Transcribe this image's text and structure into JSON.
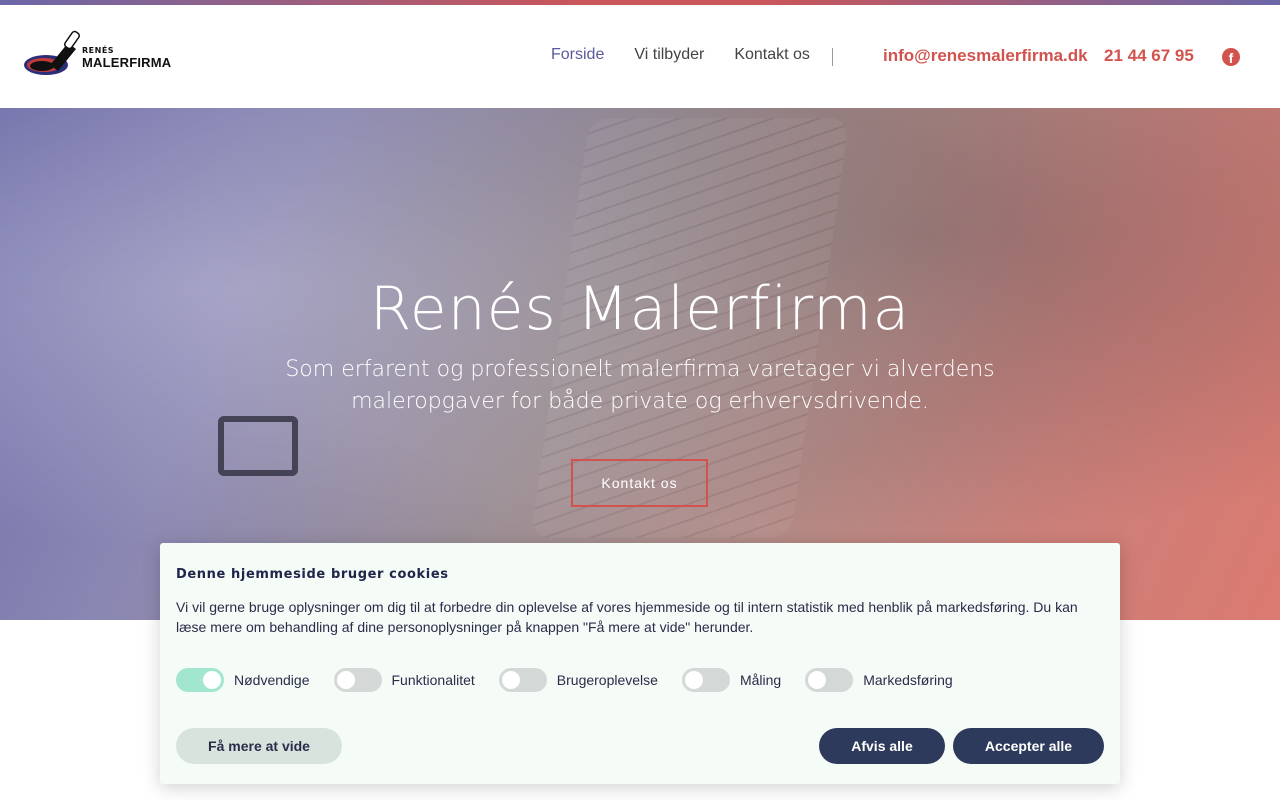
{
  "brand": {
    "small": "RENÉS",
    "big": "MALERFIRMA",
    "colors": {
      "accent": "#d2534d",
      "nav_active": "#5b5a9c",
      "dark": "#2e3a5c"
    }
  },
  "nav": {
    "items": [
      {
        "label": "Forside",
        "active": true
      },
      {
        "label": "Vi tilbyder",
        "active": false
      },
      {
        "label": "Kontakt os",
        "active": false
      }
    ]
  },
  "contact": {
    "email": "info@renesmalerfirma.dk",
    "phone": "21 44 67 95",
    "social_icon": "facebook-icon",
    "social_glyph": "f"
  },
  "hero": {
    "title": "Renés Malerfirma",
    "subtitle": "Som erfarent og professionelt malerfirma varetager vi alverdens maleropgaver for både private og erhvervsdrivende.",
    "cta": "Kontakt os"
  },
  "cookie": {
    "title": "Denne hjemmeside bruger cookies",
    "text": "Vi vil gerne bruge oplysninger om dig til at forbedre din oplevelse af vores hjemmeside og til intern statistik med henblik på markedsføring. Du kan læse mere om behandling af dine personoplysninger på knappen \"Få mere at vide\" herunder.",
    "toggles": [
      {
        "label": "Nødvendige",
        "on": true
      },
      {
        "label": "Funktionalitet",
        "on": false
      },
      {
        "label": "Brugeroplevelse",
        "on": false
      },
      {
        "label": "Måling",
        "on": false
      },
      {
        "label": "Markedsføring",
        "on": false
      }
    ],
    "more_label": "Få mere at vide",
    "reject_label": "Afvis alle",
    "accept_label": "Accepter alle"
  }
}
